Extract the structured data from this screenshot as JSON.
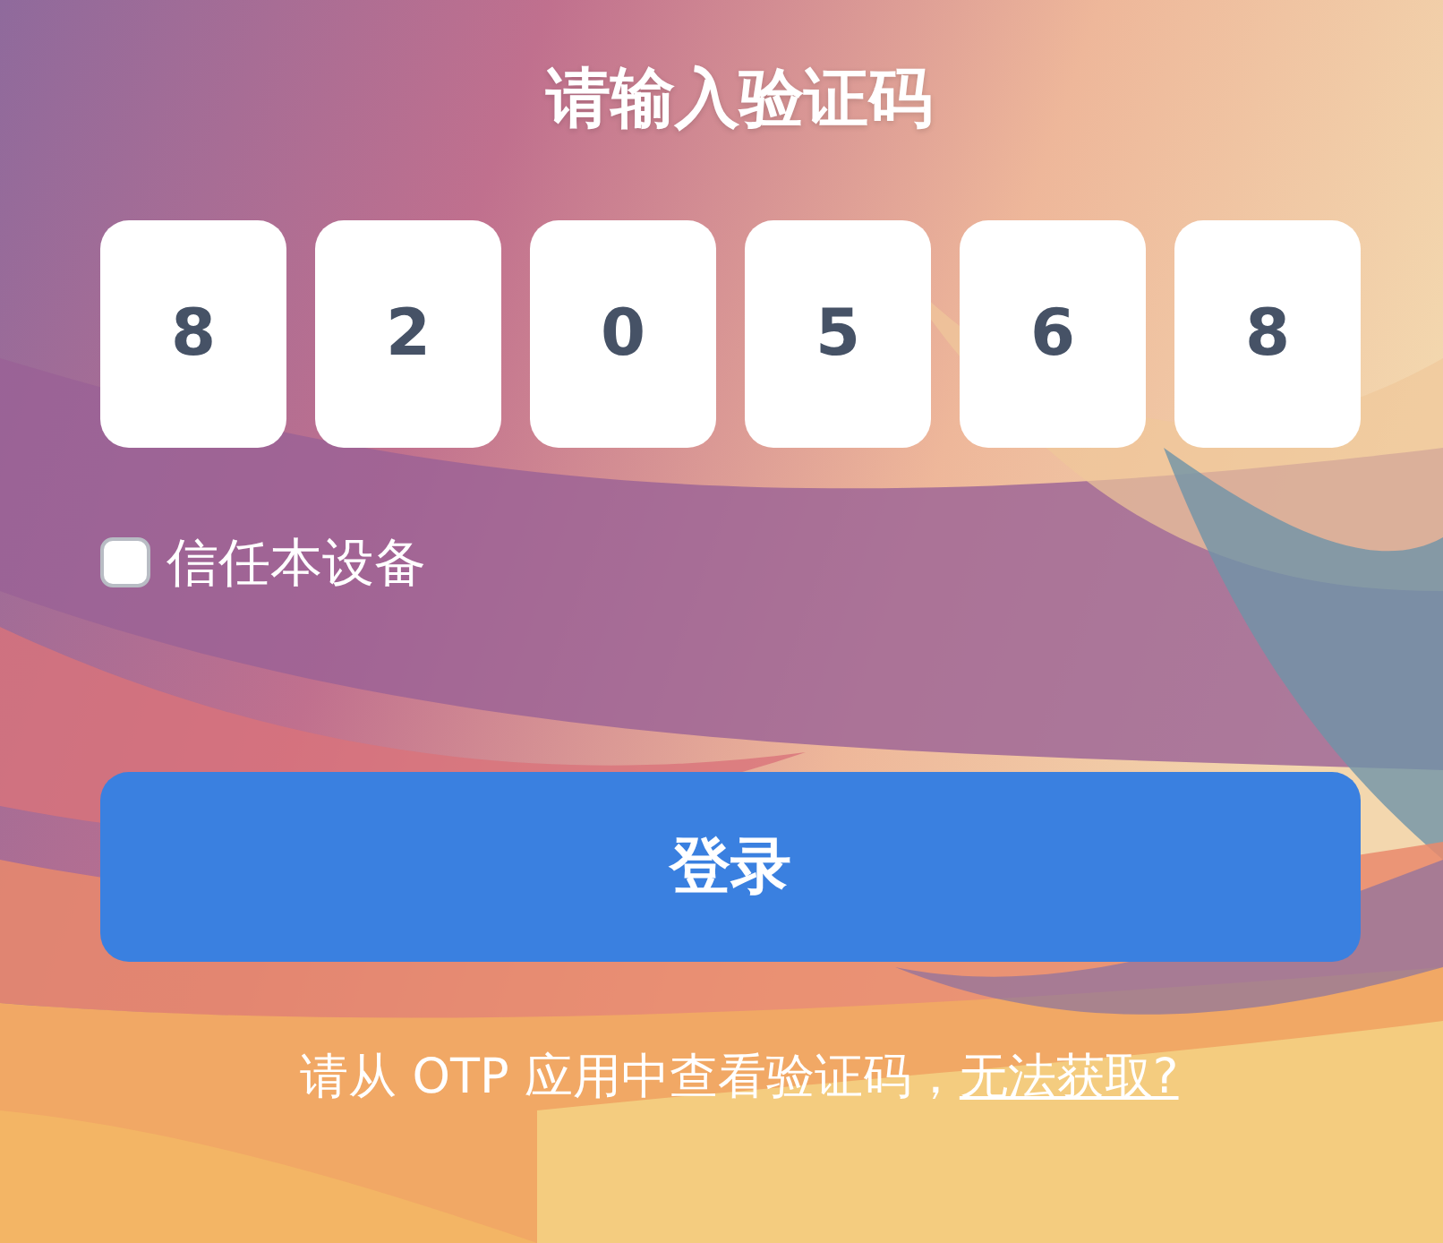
{
  "title": "请输入验证码",
  "otp_digits": [
    "8",
    "2",
    "0",
    "5",
    "6",
    "8"
  ],
  "trust_device": {
    "label": "信任本设备",
    "checked": false
  },
  "login_button": "登录",
  "hint": {
    "text": "请从 OTP 应用中查看验证码，",
    "link": "无法获取?"
  }
}
